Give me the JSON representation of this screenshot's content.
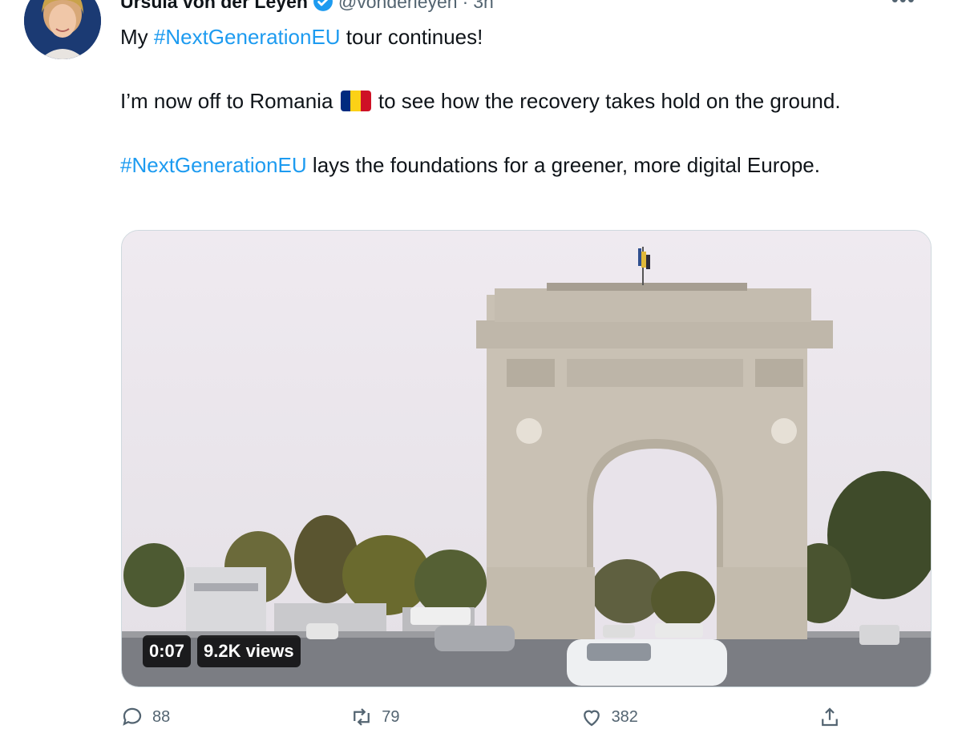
{
  "tweet": {
    "author_name": "Ursula von der Leyen",
    "handle": "@vonderleyen",
    "separator": "·",
    "time": "3h",
    "more_icon": "more-icon",
    "lines": {
      "l1_pre": "My ",
      "l1_tag": "#NextGenerationEU",
      "l1_post": " tour continues!",
      "l2_pre": "I’m now off to Romania ",
      "l2_post": " to see how the recovery takes hold on the ground.",
      "l3_tag": "#NextGenerationEU",
      "l3_post": " lays the foundations for a greener, more digital Europe."
    },
    "flag_colors": [
      "#002b7f",
      "#fcd116",
      "#ce1126"
    ],
    "hashtag_color": "#1d9bf0",
    "video": {
      "duration": "0:07",
      "views": "9.2K views"
    },
    "actions": {
      "reply_count": "88",
      "retweet_count": "79",
      "like_count": "382"
    }
  }
}
